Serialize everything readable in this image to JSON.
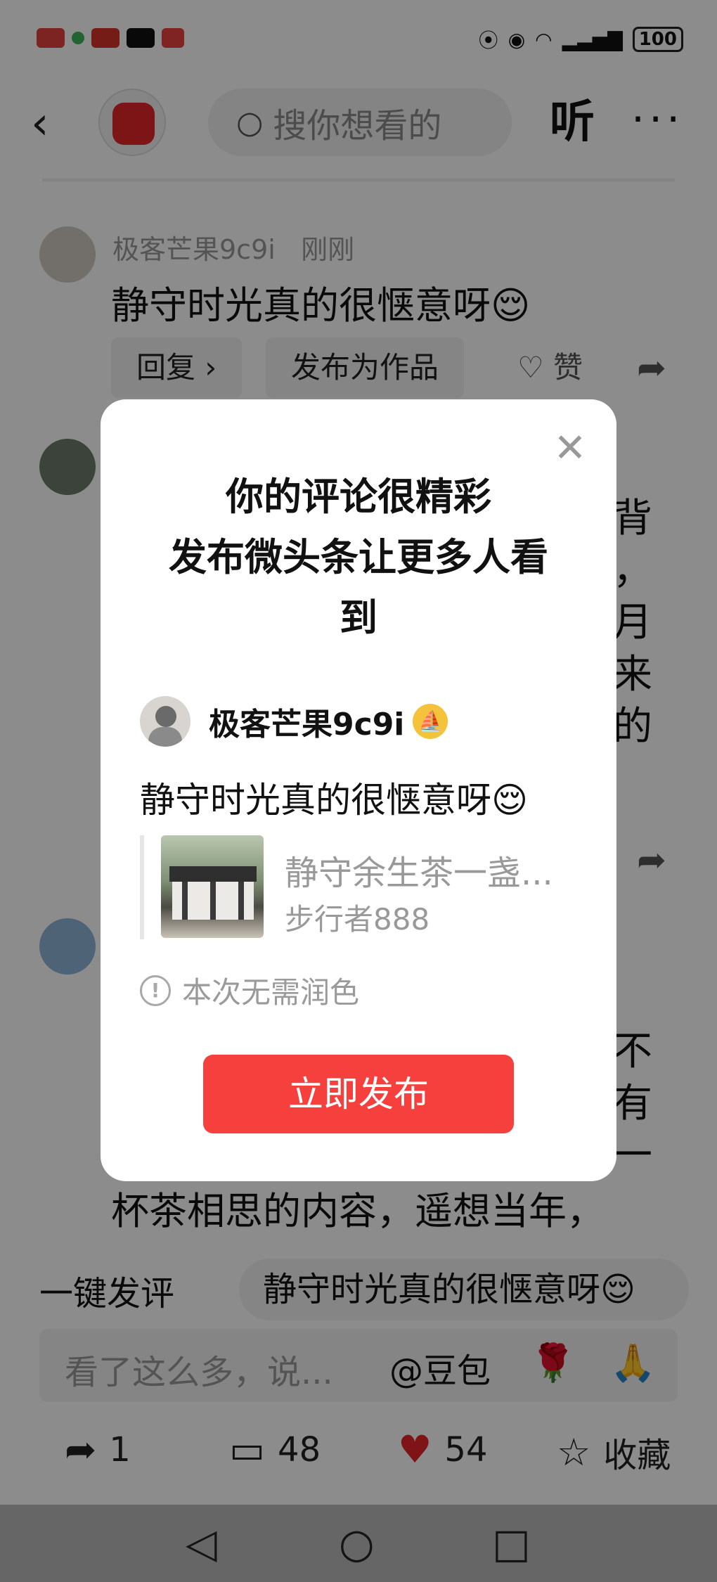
{
  "status_bar": {
    "battery": "100"
  },
  "top_bar": {
    "search_placeholder": "搜你想看的",
    "listen_label": "听",
    "more_label": "···"
  },
  "comments": [
    {
      "author": "极客芒果9c9i",
      "time": "刚刚",
      "text": "静守时光真的很惬意呀😌",
      "reply_label": "回复 ›",
      "post_label": "发布为作品",
      "like_label": "赞"
    },
    {
      "partial_lines": [
        "背",
        "，",
        "月",
        "来",
        "的"
      ]
    },
    {
      "partial_lines": [
        "不",
        "有",
        "一"
      ],
      "visible_line": "杯茶相思的内容，遥想当年，"
    }
  ],
  "quick_reply": {
    "label": "一键发评",
    "suggestion": "静守时光真的很惬意呀😌"
  },
  "comment_input": {
    "placeholder": "看了这么多，说...",
    "mention": "@豆包",
    "emoji1": "🌹",
    "emoji2": "🙏"
  },
  "actions": {
    "share_count": "1",
    "comment_count": "48",
    "like_count": "54",
    "favorite_label": "收藏"
  },
  "dialog": {
    "title_lines": [
      "你的评论很精彩",
      "发布微头条让更多人看",
      "到"
    ],
    "author_name": "极客芒果9c9i",
    "comment_text": "静守时光真的很惬意呀😌",
    "quoted_title": "静守余生茶一盏...",
    "quoted_author": "步行者888",
    "notice": "本次无需润色",
    "publish_button": "立即发布"
  },
  "colors": {
    "accent_red": "#f5403d",
    "badge_yellow": "#f5c33b",
    "like_red": "#e8262b"
  }
}
